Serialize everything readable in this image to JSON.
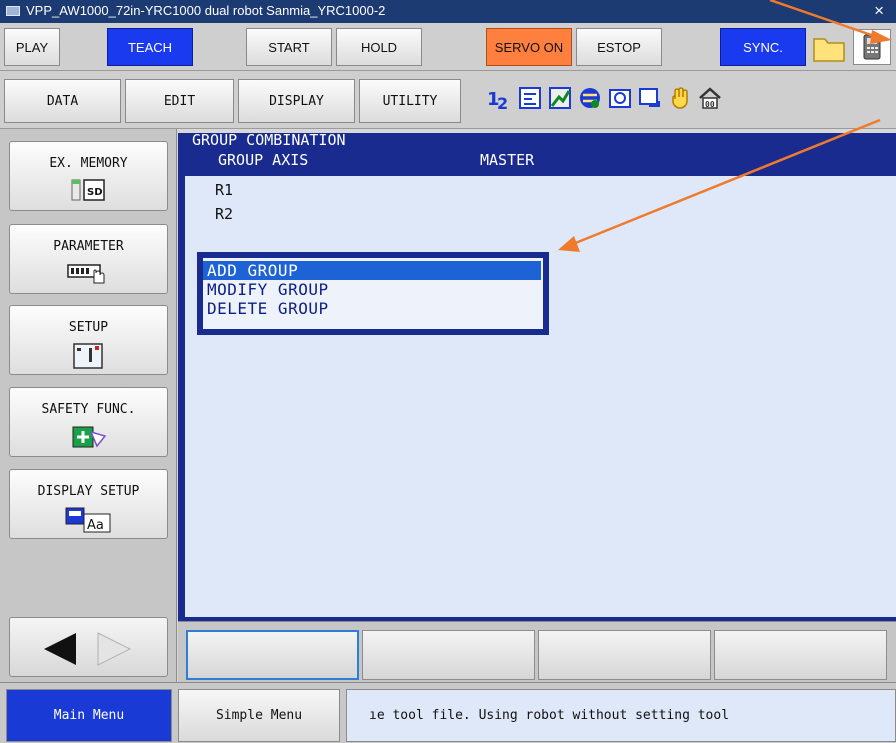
{
  "window": {
    "title": "VPP_AW1000_72in-YRC1000 dual robot  Sanmia_YRC1000-2",
    "close_glyph": "×"
  },
  "toolbar1": {
    "play": "PLAY",
    "teach": "TEACH",
    "start": "START",
    "hold": "HOLD",
    "servo_on": "SERVO ON",
    "estop": "ESTOP",
    "sync": "SYNC."
  },
  "toolbar2": {
    "data": "DATA",
    "edit": "EDIT",
    "display": "DISPLAY",
    "utility": "UTILITY",
    "icons": [
      "one-two-icon",
      "document-edit-icon",
      "chart-icon",
      "globe-tool-icon",
      "camera-icon",
      "monitor-arrow-icon",
      "hand-icon",
      "home-icon"
    ]
  },
  "left_menu": {
    "items": [
      {
        "label": "EX. MEMORY",
        "icon": "sd-card-icon"
      },
      {
        "label": "PARAMETER",
        "icon": "parameter-hand-icon"
      },
      {
        "label": "SETUP",
        "icon": "setup-panel-icon"
      },
      {
        "label": "SAFETY FUNC.",
        "icon": "safety-plus-icon"
      },
      {
        "label": "DISPLAY SETUP",
        "icon": "display-font-icon"
      }
    ],
    "sd_text": "SD",
    "font_text": "Aa"
  },
  "main": {
    "title": "GROUP COMBINATION",
    "col_group_axis": "GROUP AXIS",
    "col_master": "MASTER",
    "rows": [
      "R1",
      "R2"
    ]
  },
  "popup": {
    "items": [
      "ADD GROUP",
      "MODIFY GROUP",
      "DELETE GROUP"
    ],
    "selected_index": 0
  },
  "statusbar": {
    "main_menu": "Main Menu",
    "simple_menu": "Simple Menu",
    "message": "ıe tool file.   Using robot without setting tool"
  },
  "colors": {
    "accent_blue": "#1a3af0",
    "servo_orange": "#ff7f3f",
    "panel_navy": "#1a2b8f",
    "annotation_orange": "#f07a2c"
  }
}
